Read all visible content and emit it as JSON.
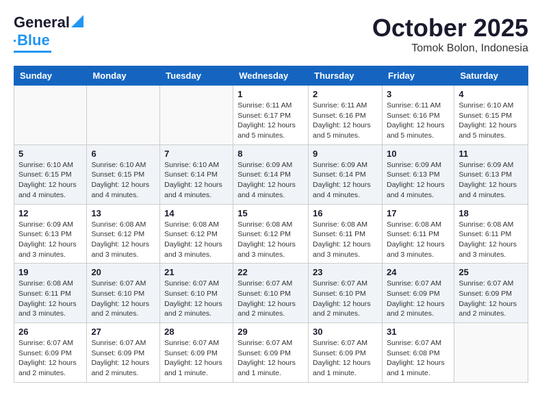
{
  "logo": {
    "line1": "General",
    "line2": "Blue"
  },
  "title": "October 2025",
  "subtitle": "Tomok Bolon, Indonesia",
  "weekdays": [
    "Sunday",
    "Monday",
    "Tuesday",
    "Wednesday",
    "Thursday",
    "Friday",
    "Saturday"
  ],
  "weeks": [
    [
      {
        "day": "",
        "info": ""
      },
      {
        "day": "",
        "info": ""
      },
      {
        "day": "",
        "info": ""
      },
      {
        "day": "1",
        "info": "Sunrise: 6:11 AM\nSunset: 6:17 PM\nDaylight: 12 hours\nand 5 minutes."
      },
      {
        "day": "2",
        "info": "Sunrise: 6:11 AM\nSunset: 6:16 PM\nDaylight: 12 hours\nand 5 minutes."
      },
      {
        "day": "3",
        "info": "Sunrise: 6:11 AM\nSunset: 6:16 PM\nDaylight: 12 hours\nand 5 minutes."
      },
      {
        "day": "4",
        "info": "Sunrise: 6:10 AM\nSunset: 6:15 PM\nDaylight: 12 hours\nand 5 minutes."
      }
    ],
    [
      {
        "day": "5",
        "info": "Sunrise: 6:10 AM\nSunset: 6:15 PM\nDaylight: 12 hours\nand 4 minutes."
      },
      {
        "day": "6",
        "info": "Sunrise: 6:10 AM\nSunset: 6:15 PM\nDaylight: 12 hours\nand 4 minutes."
      },
      {
        "day": "7",
        "info": "Sunrise: 6:10 AM\nSunset: 6:14 PM\nDaylight: 12 hours\nand 4 minutes."
      },
      {
        "day": "8",
        "info": "Sunrise: 6:09 AM\nSunset: 6:14 PM\nDaylight: 12 hours\nand 4 minutes."
      },
      {
        "day": "9",
        "info": "Sunrise: 6:09 AM\nSunset: 6:14 PM\nDaylight: 12 hours\nand 4 minutes."
      },
      {
        "day": "10",
        "info": "Sunrise: 6:09 AM\nSunset: 6:13 PM\nDaylight: 12 hours\nand 4 minutes."
      },
      {
        "day": "11",
        "info": "Sunrise: 6:09 AM\nSunset: 6:13 PM\nDaylight: 12 hours\nand 4 minutes."
      }
    ],
    [
      {
        "day": "12",
        "info": "Sunrise: 6:09 AM\nSunset: 6:13 PM\nDaylight: 12 hours\nand 3 minutes."
      },
      {
        "day": "13",
        "info": "Sunrise: 6:08 AM\nSunset: 6:12 PM\nDaylight: 12 hours\nand 3 minutes."
      },
      {
        "day": "14",
        "info": "Sunrise: 6:08 AM\nSunset: 6:12 PM\nDaylight: 12 hours\nand 3 minutes."
      },
      {
        "day": "15",
        "info": "Sunrise: 6:08 AM\nSunset: 6:12 PM\nDaylight: 12 hours\nand 3 minutes."
      },
      {
        "day": "16",
        "info": "Sunrise: 6:08 AM\nSunset: 6:11 PM\nDaylight: 12 hours\nand 3 minutes."
      },
      {
        "day": "17",
        "info": "Sunrise: 6:08 AM\nSunset: 6:11 PM\nDaylight: 12 hours\nand 3 minutes."
      },
      {
        "day": "18",
        "info": "Sunrise: 6:08 AM\nSunset: 6:11 PM\nDaylight: 12 hours\nand 3 minutes."
      }
    ],
    [
      {
        "day": "19",
        "info": "Sunrise: 6:08 AM\nSunset: 6:11 PM\nDaylight: 12 hours\nand 3 minutes."
      },
      {
        "day": "20",
        "info": "Sunrise: 6:07 AM\nSunset: 6:10 PM\nDaylight: 12 hours\nand 2 minutes."
      },
      {
        "day": "21",
        "info": "Sunrise: 6:07 AM\nSunset: 6:10 PM\nDaylight: 12 hours\nand 2 minutes."
      },
      {
        "day": "22",
        "info": "Sunrise: 6:07 AM\nSunset: 6:10 PM\nDaylight: 12 hours\nand 2 minutes."
      },
      {
        "day": "23",
        "info": "Sunrise: 6:07 AM\nSunset: 6:10 PM\nDaylight: 12 hours\nand 2 minutes."
      },
      {
        "day": "24",
        "info": "Sunrise: 6:07 AM\nSunset: 6:09 PM\nDaylight: 12 hours\nand 2 minutes."
      },
      {
        "day": "25",
        "info": "Sunrise: 6:07 AM\nSunset: 6:09 PM\nDaylight: 12 hours\nand 2 minutes."
      }
    ],
    [
      {
        "day": "26",
        "info": "Sunrise: 6:07 AM\nSunset: 6:09 PM\nDaylight: 12 hours\nand 2 minutes."
      },
      {
        "day": "27",
        "info": "Sunrise: 6:07 AM\nSunset: 6:09 PM\nDaylight: 12 hours\nand 2 minutes."
      },
      {
        "day": "28",
        "info": "Sunrise: 6:07 AM\nSunset: 6:09 PM\nDaylight: 12 hours\nand 1 minute."
      },
      {
        "day": "29",
        "info": "Sunrise: 6:07 AM\nSunset: 6:09 PM\nDaylight: 12 hours\nand 1 minute."
      },
      {
        "day": "30",
        "info": "Sunrise: 6:07 AM\nSunset: 6:09 PM\nDaylight: 12 hours\nand 1 minute."
      },
      {
        "day": "31",
        "info": "Sunrise: 6:07 AM\nSunset: 6:08 PM\nDaylight: 12 hours\nand 1 minute."
      },
      {
        "day": "",
        "info": ""
      }
    ]
  ]
}
